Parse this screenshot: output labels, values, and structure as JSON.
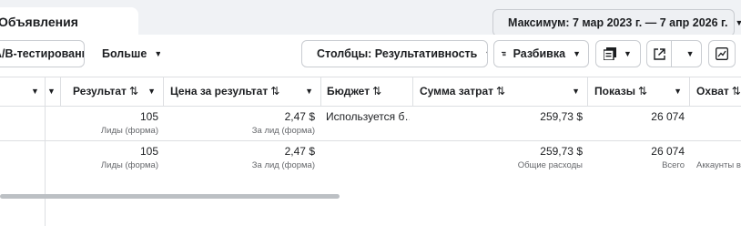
{
  "tab": {
    "label": "Объявления"
  },
  "date_range": {
    "label": "Максимум: 7 мар 2023 г. — 7 апр 2026 г."
  },
  "toolbar": {
    "ab_test_label": "А/В-тестирование",
    "more_label": "Больше",
    "columns_label": "Столбцы: Результативность",
    "breakdown_label": "Разбивка"
  },
  "columns": [
    {
      "label": "Результат",
      "sortable": true
    },
    {
      "label": "Цена за результат",
      "sortable": true
    },
    {
      "label": "Бюджет",
      "sortable": true
    },
    {
      "label": "Сумма затрат",
      "sortable": true
    },
    {
      "label": "Показы",
      "sortable": true
    },
    {
      "label": "Охват",
      "sortable": true
    }
  ],
  "sort_icon": "⇅",
  "rows": [
    {
      "result": "105",
      "result_sub": "Лиды (форма)",
      "cpr": "2,47 $",
      "cpr_sub": "За лид (форма)",
      "budget": "Используется б…",
      "budget_sub": "",
      "spend": "259,73 $",
      "spend_sub": "",
      "impressions": "26 074",
      "impressions_sub": "",
      "reach": "",
      "reach_sub": ""
    },
    {
      "result": "105",
      "result_sub": "Лиды (форма)",
      "cpr": "2,47 $",
      "cpr_sub": "За лид (форма)",
      "budget": "",
      "budget_sub": "",
      "spend": "259,73 $",
      "spend_sub": "Общие расходы",
      "impressions": "26 074",
      "impressions_sub": "Всего",
      "reach": "",
      "reach_sub": "Аккаунты в"
    }
  ],
  "colors": {
    "border": "#dddfe2",
    "muted": "#65676b",
    "text": "#1c1e21",
    "page_bg": "#f0f2f5"
  }
}
